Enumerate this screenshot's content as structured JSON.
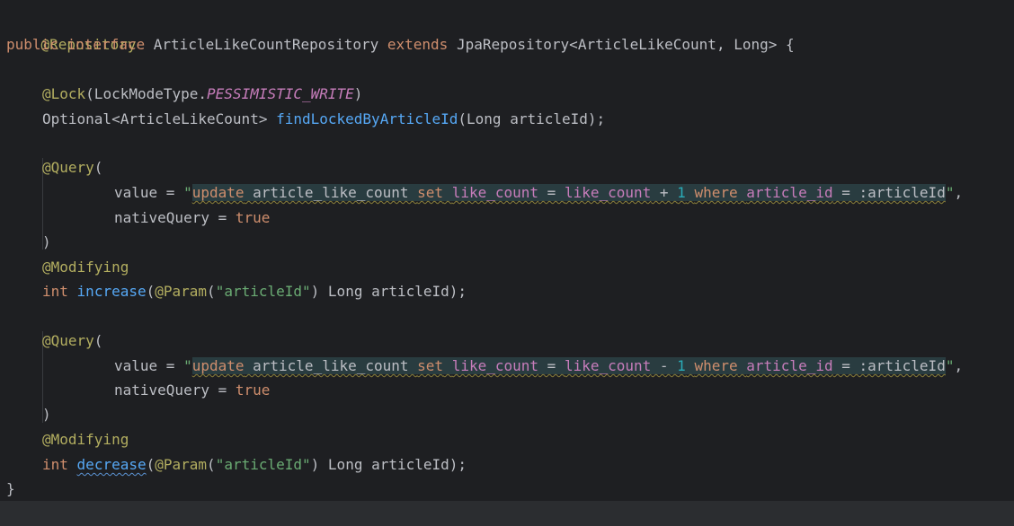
{
  "editor": {
    "lines": {
      "l1": {
        "annotation": "@Repository"
      },
      "l2": {
        "kw_public": "public",
        "kw_interface": "interface",
        "name": "ArticleLikeCountRepository",
        "kw_extends": "extends",
        "rest": "JpaRepository<ArticleLikeCount, Long> {"
      },
      "l4": {
        "annotation": "@Lock",
        "open": "(LockModeType.",
        "const": "PESSIMISTIC_WRITE",
        "close": ")"
      },
      "l5": {
        "type": "Optional<ArticleLikeCount> ",
        "method": "findLockedByArticleId",
        "params": "(Long articleId);"
      },
      "l7": {
        "annotation": "@Query",
        "open": "("
      },
      "l8": {
        "key": "value = ",
        "quote_open": "\"",
        "sql_update": "update",
        "sql_table": " article_like_count ",
        "sql_set": "set",
        "sql_sp1": " ",
        "sql_col1": "like_count",
        "sql_eq1": " = ",
        "sql_col2": "like_count",
        "sql_op": " + ",
        "sql_num": "1",
        "sql_sp2": " ",
        "sql_where": "where",
        "sql_sp3": " ",
        "sql_col3": "article_id",
        "sql_eq2": " = :articleId",
        "quote_close": "\"",
        "comma": ","
      },
      "l9": {
        "key": "nativeQuery = ",
        "val": "true"
      },
      "l10": {
        "close": ")"
      },
      "l11": {
        "annotation": "@Modifying"
      },
      "l12": {
        "kw_int": "int",
        "sp": " ",
        "method": "increase",
        "open": "(",
        "param_ann": "@Param",
        "param_open": "(",
        "param_str": "\"articleId\"",
        "rest": ") Long articleId);"
      },
      "l14": {
        "annotation": "@Query",
        "open": "("
      },
      "l15": {
        "key": "value = ",
        "quote_open": "\"",
        "sql_update": "update",
        "sql_table": " article_like_count ",
        "sql_set": "set",
        "sql_sp1": " ",
        "sql_col1": "like_count",
        "sql_eq1": " = ",
        "sql_col2": "like_count",
        "sql_op": " - ",
        "sql_num": "1",
        "sql_sp2": " ",
        "sql_where": "where",
        "sql_sp3": " ",
        "sql_col3": "article_id",
        "sql_eq2": " = :articleId",
        "quote_close": "\"",
        "comma": ","
      },
      "l16": {
        "key": "nativeQuery = ",
        "val": "true"
      },
      "l17": {
        "close": ")"
      },
      "l18": {
        "annotation": "@Modifying"
      },
      "l19": {
        "kw_int": "int",
        "sp": " ",
        "method": "decrease",
        "open": "(",
        "param_ann": "@Param",
        "param_open": "(",
        "param_str": "\"articleId\"",
        "rest": ") Long articleId);"
      },
      "l20": {
        "close": "}"
      }
    }
  },
  "colors": {
    "background": "#1e1f22",
    "text": "#bcbec4",
    "keyword": "#cf8e6d",
    "annotation": "#b3ae60",
    "method": "#56a8f5",
    "constant": "#c77dbb",
    "string": "#6aab73",
    "number": "#2aacb8",
    "sql_background": "#293c40"
  }
}
